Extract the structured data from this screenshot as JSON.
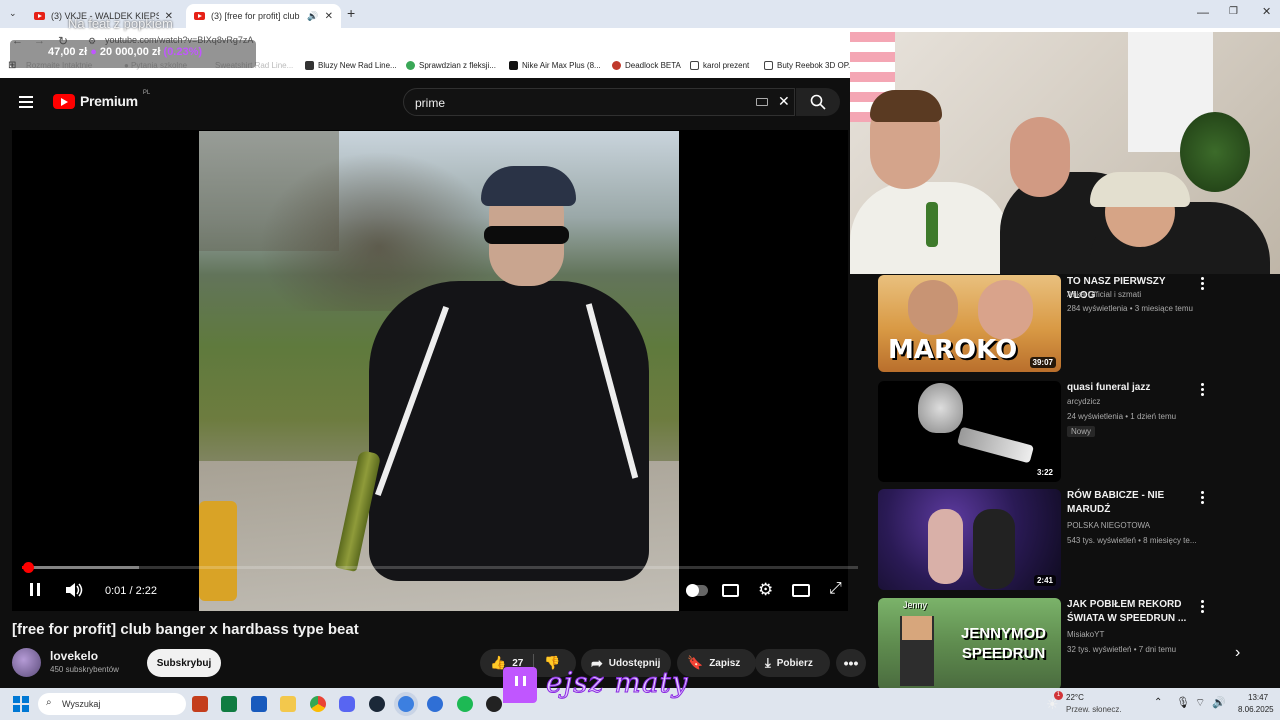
{
  "browser": {
    "tabs": [
      {
        "title": "(3) VKJE - WALDEK KIEPSKI (pro",
        "active": false
      },
      {
        "title": "(3) [free for profit] club ban",
        "active": true
      }
    ],
    "url": "youtube.com/watch?v=BIXq8vRg7zA",
    "bookmarks": [
      "Bluzy New Rad Line...",
      "Sprawdzian z fleksji...",
      "Nike Air Max Plus (8...",
      "Deadlock BETA",
      "karol prezent",
      "Buty Reebok 3D OP..."
    ]
  },
  "overlay": {
    "feat_label": "Na feat z popkiem",
    "money_a": "47,00 zł",
    "money_b": "20 000,00 zł",
    "money_pct": "(0.23%)",
    "money_progress": 0.0023,
    "twitch_name": "ejsz maty"
  },
  "youtube": {
    "logo": "Premium",
    "logo_region": "PL",
    "search_value": "prime",
    "player": {
      "time": "0:01 / 2:22",
      "progress": 0.007,
      "buffered": 0.14
    },
    "video_title": "[free for profit] club banger x hardbass type beat",
    "channel": {
      "name": "lovekelo",
      "subscribers": "450 subskrybentów",
      "subscribe_label": "Subskrybuj"
    },
    "actions": {
      "likes": "27",
      "share": "Udostępnij",
      "save": "Zapisz",
      "download": "Pobierz"
    }
  },
  "recommendations": [
    {
      "title": "TO NASZ PIERWSZY VLOG",
      "channel": "Anka Official i szmati",
      "meta": "284 wyświetlenia • 3 miesiące temu",
      "duration": "39:07",
      "thumb_text": "MAROKO",
      "badge": ""
    },
    {
      "title": "quasi funeral jazz",
      "channel": "arcydzicz",
      "meta": "24 wyświetlenia • 1 dzień temu",
      "duration": "3:22",
      "thumb_text": "",
      "badge": "Nowy"
    },
    {
      "title": "RÓW BABICZE - NIE MARUDŹ",
      "channel": "POLSKA NIEGOTOWA",
      "meta": "543 tys. wyświetleń • 8 miesięcy te...",
      "duration": "2:41",
      "thumb_text": "",
      "badge": ""
    },
    {
      "title": "JAK POBIŁEM REKORD ŚWIATA W SPEEDRUN ...",
      "channel": "MisiakoYT",
      "meta": "32 tys. wyświetleń • 7 dni temu",
      "duration": "",
      "thumb_text": "JENNYMOD SPEEDRUN",
      "thumb_tag": "Jenny",
      "badge": ""
    }
  ],
  "taskbar": {
    "search_placeholder": "Wyszukaj",
    "weather_temp": "22°C",
    "weather_desc": "Przew. słonecz.",
    "notif_count": "1",
    "time": "13:47",
    "date": "8.06.2025"
  },
  "colors": {
    "yt_red": "#ff0000",
    "twitch_purple": "#9146ff",
    "bg": "#0f0f0f"
  }
}
